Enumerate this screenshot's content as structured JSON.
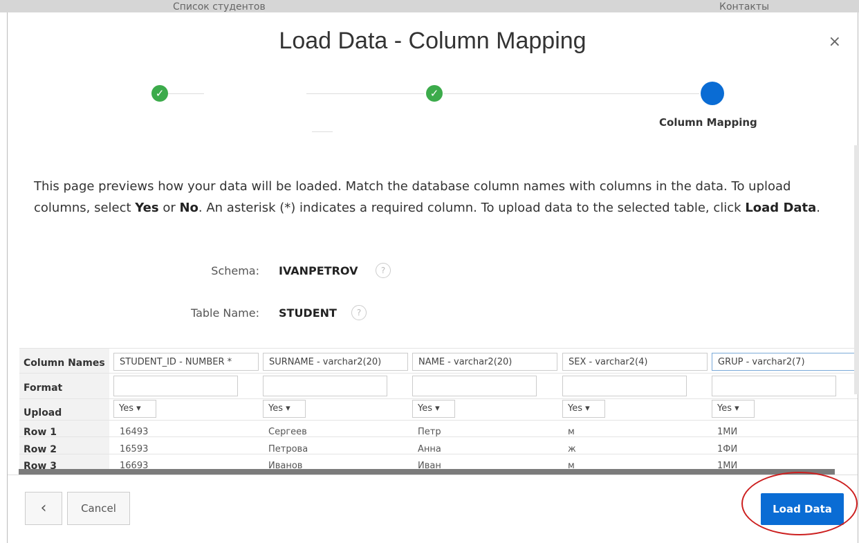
{
  "background_page": {
    "left_text": "Список студентов",
    "right_text": "Контакты"
  },
  "dialog": {
    "title": "Load Data - Column Mapping",
    "close_glyph": "×"
  },
  "wizard": {
    "steps": [
      {
        "state": "complete",
        "label": ""
      },
      {
        "state": "complete",
        "label": ""
      },
      {
        "state": "current",
        "label": "Column Mapping"
      }
    ],
    "check_glyph": "✓"
  },
  "description": {
    "part1": "This page previews how your data will be loaded. Match the database column names with columns in the data. To upload columns, select ",
    "yes": "Yes",
    "or": " or ",
    "no": "No",
    "part2": ". An asterisk (*) indicates a required column. To upload data to the selected table, click ",
    "load_data": "Load Data",
    "end": "."
  },
  "schema": {
    "label": "Schema:",
    "value": "IVANPETROV",
    "help_glyph": "?"
  },
  "table": {
    "label": "Table Name:",
    "value": "STUDENT",
    "help_glyph": "?"
  },
  "grid": {
    "row_labels": [
      "Column Names",
      "Format",
      "Upload",
      "Row 1",
      "Row 2",
      "Row 3"
    ],
    "columns": [
      {
        "name": "STUDENT_ID - NUMBER *",
        "format": "",
        "upload": "Yes ▾"
      },
      {
        "name": "SURNAME - varchar2(20)",
        "format": "",
        "upload": "Yes ▾"
      },
      {
        "name": "NAME - varchar2(20)",
        "format": "",
        "upload": "Yes ▾"
      },
      {
        "name": "SEX - varchar2(4)",
        "format": "",
        "upload": "Yes ▾"
      },
      {
        "name": "GRUP - varchar2(7)",
        "format": "",
        "upload": "Yes ▾"
      }
    ],
    "rows": [
      [
        "16493",
        "Сергеев",
        "Петр",
        "м",
        "1МИ"
      ],
      [
        "16593",
        "Петрова",
        "Анна",
        "ж",
        "1ФИ"
      ],
      [
        "16693",
        "Иванов",
        "Иван",
        "м",
        "1МИ"
      ]
    ]
  },
  "footer": {
    "back_glyph": "‹",
    "cancel_label": "Cancel",
    "load_label": "Load Data"
  },
  "colors": {
    "accent": "#0a6cd4",
    "success": "#3cab4b",
    "annotation": "#cc1f1f"
  }
}
